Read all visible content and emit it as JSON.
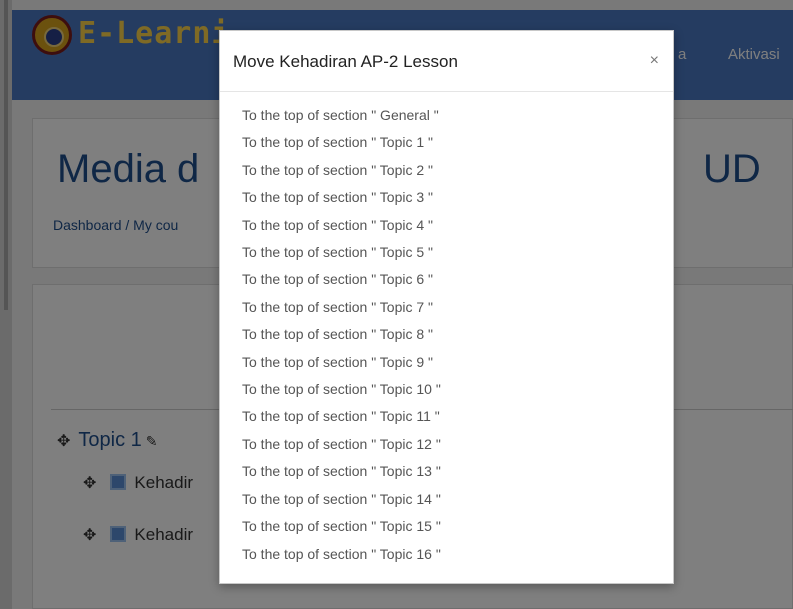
{
  "navbar": {
    "brand": "E-Learni",
    "links": [
      "a",
      "Aktivasi"
    ]
  },
  "course": {
    "title_left": "Media d",
    "title_right": "UD",
    "breadcrumb": "Dashboard / My cou"
  },
  "content": {
    "topic_title": "Topic 1",
    "activities": [
      "Kehadir",
      "Kehadir"
    ]
  },
  "modal": {
    "title": "Move Kehadiran AP-2 Lesson",
    "close_label": "×",
    "options": [
      "To the top of section \" General \"",
      "To the top of section \" Topic 1 \"",
      "To the top of section \" Topic 2 \"",
      "To the top of section \" Topic 3 \"",
      "To the top of section \" Topic 4 \"",
      "To the top of section \" Topic 5 \"",
      "To the top of section \" Topic 6 \"",
      "To the top of section \" Topic 7 \"",
      "To the top of section \" Topic 8 \"",
      "To the top of section \" Topic 9 \"",
      "To the top of section \" Topic 10 \"",
      "To the top of section \" Topic 11 \"",
      "To the top of section \" Topic 12 \"",
      "To the top of section \" Topic 13 \"",
      "To the top of section \" Topic 14 \"",
      "To the top of section \" Topic 15 \"",
      "To the top of section \" Topic 16 \""
    ]
  },
  "colors": {
    "navbar": "#4a78c2",
    "brand_text": "#ffd54a",
    "link": "#1f4e8c",
    "overlay": "rgba(0,0,0,0.5)"
  }
}
